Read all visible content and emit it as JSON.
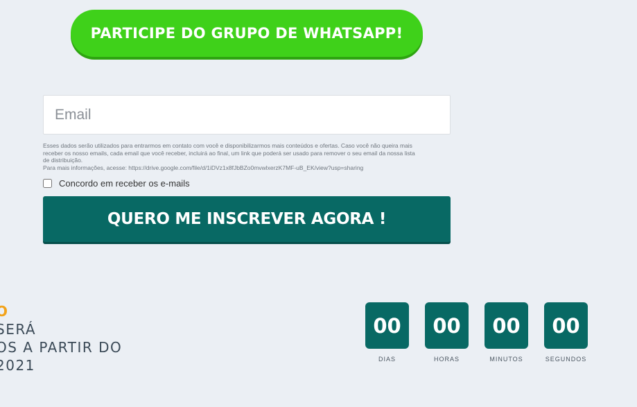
{
  "whatsapp_button": {
    "label": "PARTICIPE DO GRUPO DE WHATSAPP!"
  },
  "form": {
    "email_placeholder": "Email",
    "disclaimer_lines": [
      "Esses dados serão utilizados para entrarmos em contato com você e disponibilizarmos mais conteúdos e ofertas. Caso você não queira mais",
      "receber os nosso emails, cada email que você receber, incluirá ao final, um link que poderá ser usado para remover o seu email da nossa lista",
      "de distribuição.",
      "Para mais informações, acesse: https://drive.google.com/file/d/1iDVz1x8fJbBZo0mvwlxerzK7MF-uB_EK/view?usp=sharing"
    ],
    "consent_label": "Concordo em receber os e-mails",
    "submit_label": "QUERO ME INSCREVER AGORA !"
  },
  "side_text": {
    "line1": "O",
    "line2": "SERÁ",
    "line3": "OS A PARTIR DO",
    "line4": "2021"
  },
  "countdown": {
    "units": [
      {
        "value": "00",
        "label": "DIAS"
      },
      {
        "value": "00",
        "label": "HORAS"
      },
      {
        "value": "00",
        "label": "MINUTOS"
      },
      {
        "value": "00",
        "label": "SEGUNDOS"
      }
    ]
  },
  "colors": {
    "background": "#ebeff4",
    "whatsapp_green": "#3fd11a",
    "primary_teal": "#086964",
    "accent_orange": "#f2a31b"
  }
}
